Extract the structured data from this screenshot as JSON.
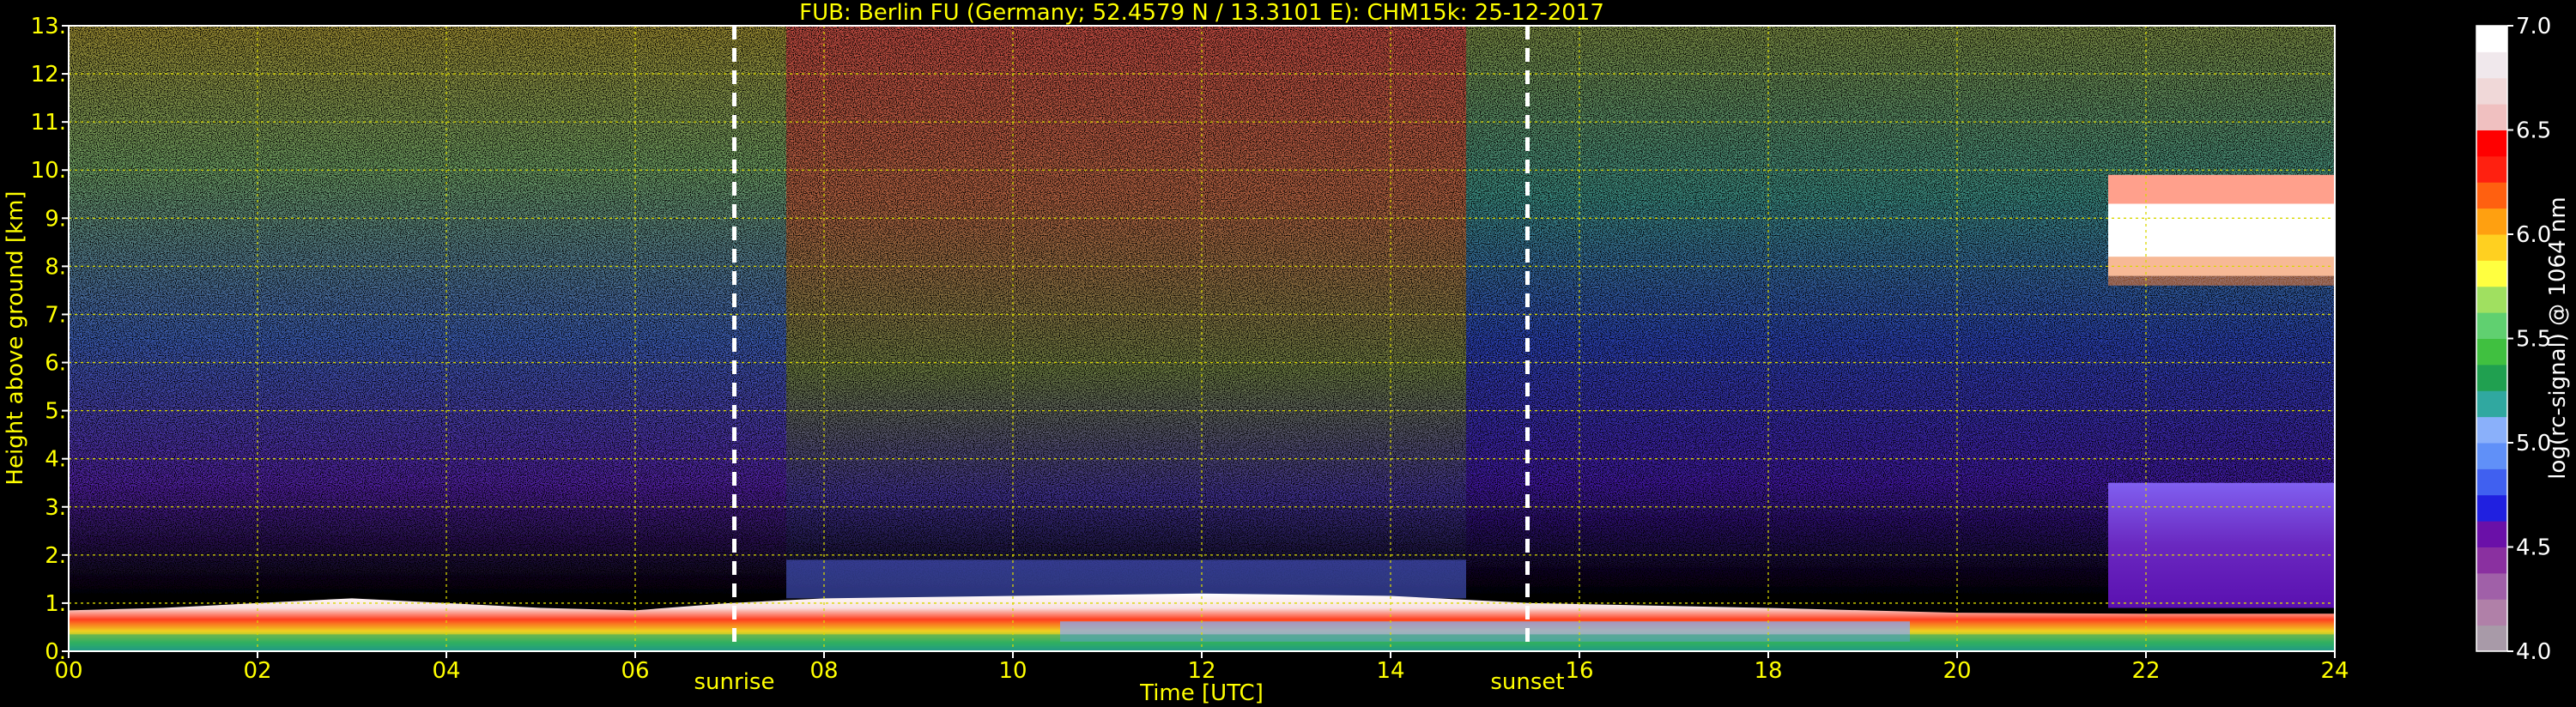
{
  "chart_data": {
    "type": "heatmap",
    "title": "FUB: Berlin FU (Germany; 52.4579 N / 13.3101 E):    CHM15k: 25-12-2017",
    "xlabel": "Time [UTC]",
    "ylabel": "Height above ground [km]",
    "x_ticks": [
      "00",
      "02",
      "04",
      "06",
      "08",
      "10",
      "12",
      "14",
      "16",
      "18",
      "20",
      "22",
      "24"
    ],
    "y_ticks": [
      "0.",
      "1.",
      "2.",
      "3.",
      "4.",
      "5.",
      "6.",
      "7.",
      "8.",
      "9.",
      "10.",
      "11.",
      "12.",
      "13."
    ],
    "xlim": [
      0,
      24
    ],
    "ylim": [
      0,
      13
    ],
    "grid": true,
    "markers": [
      {
        "label": "sunrise",
        "x": 7.05
      },
      {
        "label": "sunset",
        "x": 15.45
      }
    ],
    "colorbar": {
      "label": "log(rc-signal) @ 1064 nm",
      "ticks": [
        "4.0",
        "4.5",
        "5.0",
        "5.5",
        "6.0",
        "6.5",
        "7.0"
      ],
      "range": [
        4.0,
        7.0
      ],
      "colors": [
        "#a89aa8",
        "#b080a8",
        "#a060a8",
        "#8a30a0",
        "#6a10a8",
        "#2020e0",
        "#4060f0",
        "#6090f8",
        "#8ab0fa",
        "#30a8a0",
        "#20a050",
        "#40c040",
        "#60d070",
        "#a0e060",
        "#ffff40",
        "#ffd020",
        "#ffa010",
        "#ff6010",
        "#ff2010",
        "#ff0000",
        "#f0c0c0",
        "#f0d8d8",
        "#f0e8ec",
        "#ffffff"
      ]
    }
  },
  "colors": {
    "text": "#ffff00",
    "axis": "#ffffff",
    "grid": "#d8d800",
    "marker": "#ffffff"
  }
}
